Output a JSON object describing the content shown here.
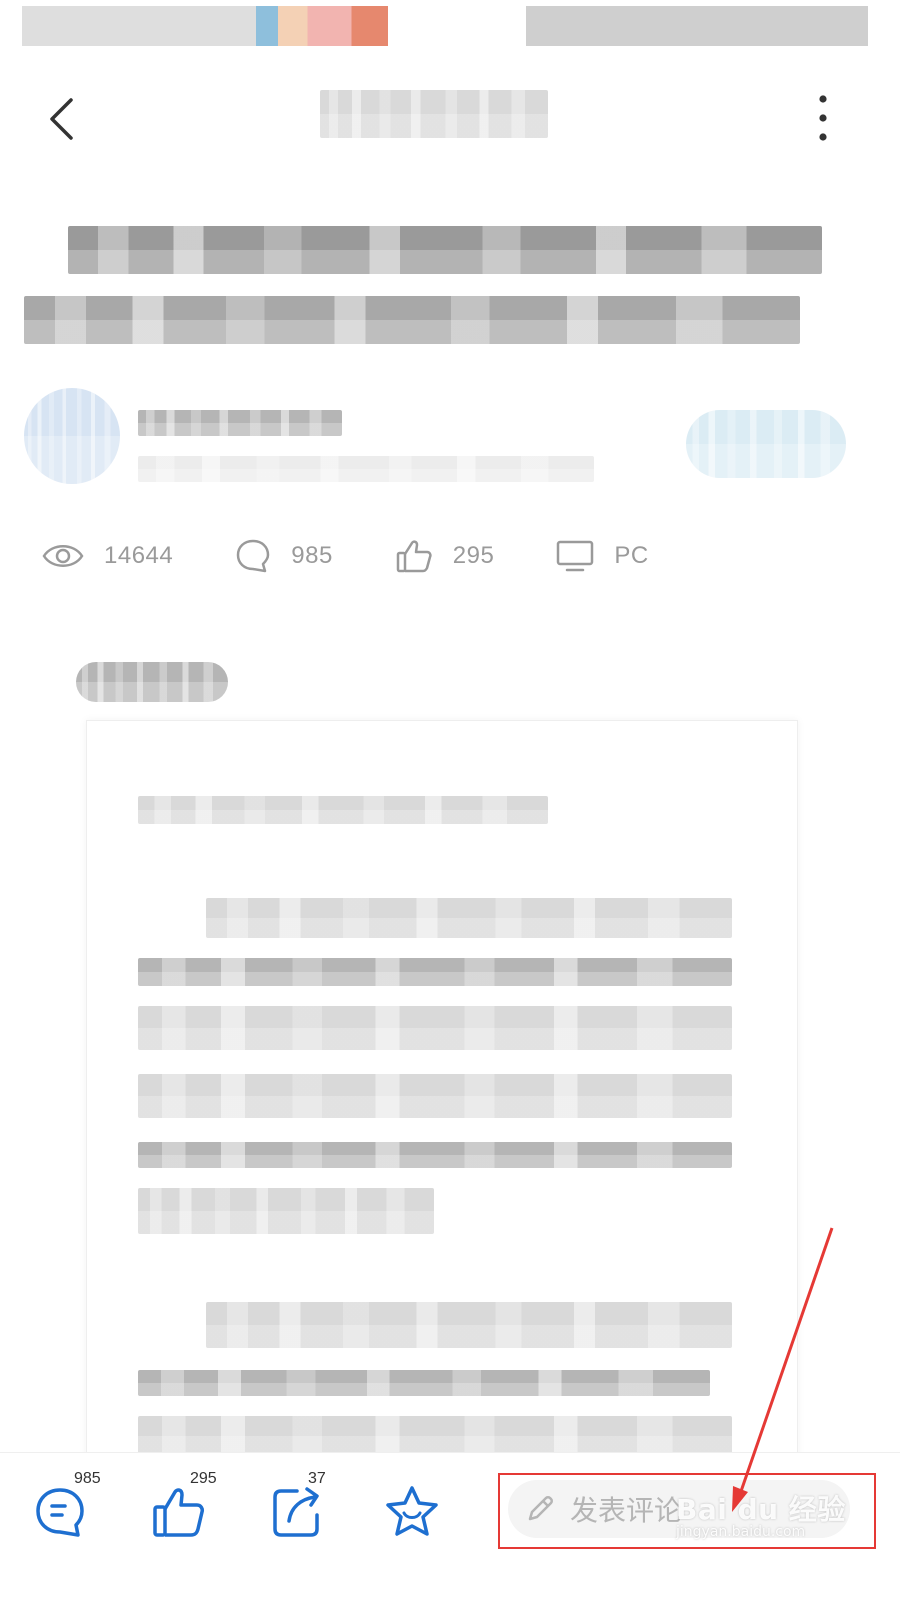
{
  "stats": {
    "views": "14644",
    "comments": "985",
    "likes": "295",
    "device": "PC"
  },
  "bottom_bar": {
    "comment_count": "985",
    "like_count": "295",
    "share_count": "37",
    "comment_placeholder": "发表评论"
  },
  "watermark": {
    "logo": "Bai du 经验",
    "url": "jingyan.baidu.com"
  },
  "colors": {
    "accent_blue": "#1e6fd0",
    "annotation_red": "#e53935",
    "stat_gray": "#9a9a9a"
  },
  "icons": {
    "nav_back": "chevron-left-icon",
    "nav_more": "more-vertical-icon",
    "views": "eye-icon",
    "comments": "chat-bubble-icon",
    "likes": "thumbs-up-icon",
    "device": "monitor-icon",
    "comment_input": "pencil-icon"
  }
}
